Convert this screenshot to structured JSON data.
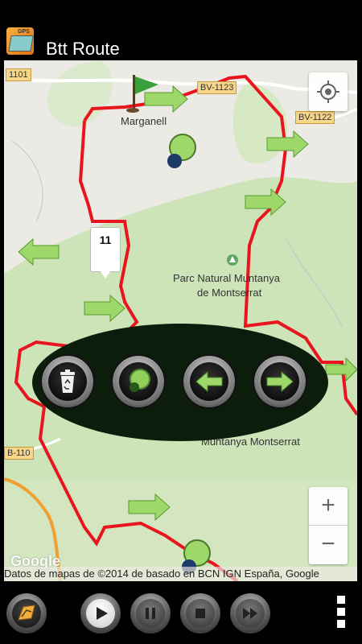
{
  "app": {
    "title": "Btt Route",
    "icon_name": "btt-route-app-icon",
    "icon_text": "GPS"
  },
  "map": {
    "labels": {
      "place_marganell": "Marganell",
      "park_line1": "Parc Natural Muntanya",
      "park_line2": "de Montserrat",
      "park_partial": "Muntanya Montserrat"
    },
    "roads": {
      "r1101": "1101",
      "bv1123": "BV-1123",
      "bv1122": "BV-1122",
      "b110": "B-110"
    },
    "marker_callout": "11",
    "attribution": "Datos de mapas de ©2014 de basado en BCN IGN España, Google",
    "logo": "Google",
    "route_color": "#e8141e",
    "zoom_in": "+",
    "zoom_out": "−"
  },
  "oval_toolbar": {
    "buttons": [
      {
        "name": "delete-waypoint-button",
        "icon": "recycle-bin-icon"
      },
      {
        "name": "add-waypoint-button",
        "icon": "green-pin-icon"
      },
      {
        "name": "previous-waypoint-button",
        "icon": "left-arrow-icon"
      },
      {
        "name": "next-waypoint-button",
        "icon": "right-arrow-icon"
      }
    ]
  },
  "bottom_bar": {
    "buttons": [
      "route-list",
      "play",
      "pause",
      "stop",
      "fast-forward",
      "overflow-menu"
    ]
  }
}
